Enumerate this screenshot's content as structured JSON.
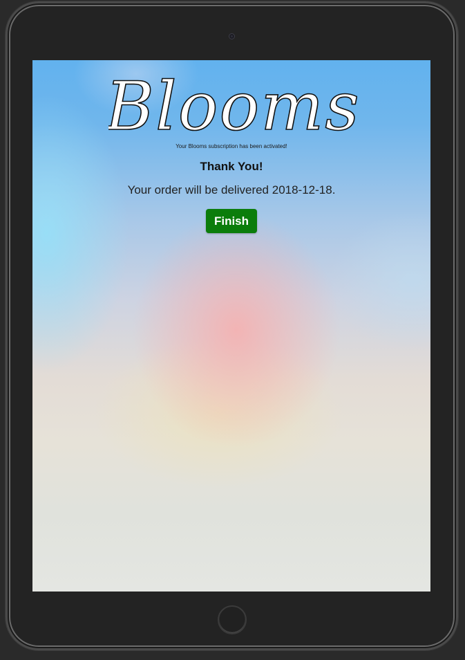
{
  "app": {
    "logo_text": "Blooms"
  },
  "confirmation": {
    "subtitle": "Your Blooms subscription has been activated!",
    "heading": "Thank You!",
    "delivery_message": "Your order will be delivered 2018-12-18.",
    "finish_label": "Finish"
  },
  "colors": {
    "finish_button": "#0b7d0b",
    "tablet_frame": "#232323",
    "sky": "#62b2ee"
  }
}
